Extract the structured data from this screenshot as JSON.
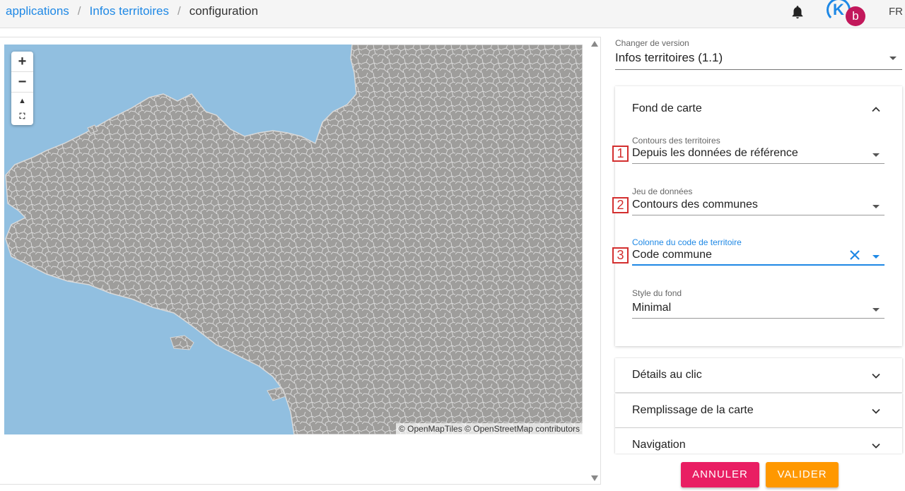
{
  "breadcrumb": {
    "items": [
      "applications",
      "Infos territoires"
    ],
    "current": "configuration",
    "separator": "/"
  },
  "header": {
    "notification_icon": "bell-icon",
    "avatar_letter": "b",
    "avatar_logo_letter": "K",
    "language": "FR"
  },
  "map": {
    "zoom_in": "+",
    "zoom_out": "−",
    "reset_north": "▲",
    "fullscreen": "⛶",
    "attribution": "© OpenMapTiles © OpenStreetMap contributors",
    "colors": {
      "sea": "#91bfe0",
      "land": "#9e9d9b",
      "borders": "#d9d9d9"
    }
  },
  "version": {
    "label": "Changer de version",
    "value": "Infos territoires (1.1)"
  },
  "fond_de_carte": {
    "title": "Fond de carte",
    "fields": [
      {
        "label": "Contours des territoires",
        "value": "Depuis les données de référence",
        "badge": "1"
      },
      {
        "label": "Jeu de données",
        "value": "Contours des communes",
        "badge": "2"
      },
      {
        "label": "Colonne du code de territoire",
        "value": "Code commune",
        "badge": "3"
      },
      {
        "label": "Style du fond",
        "value": "Minimal"
      }
    ]
  },
  "accordion": [
    {
      "label": "Détails au clic"
    },
    {
      "label": "Remplissage de la carte"
    },
    {
      "label": "Navigation"
    }
  ],
  "actions": {
    "cancel": "ANNULER",
    "validate": "VALIDER"
  },
  "colors": {
    "primary": "#1e88e5",
    "cancel": "#e91e63",
    "validate": "#ff9800",
    "badge": "#d32f2f"
  }
}
